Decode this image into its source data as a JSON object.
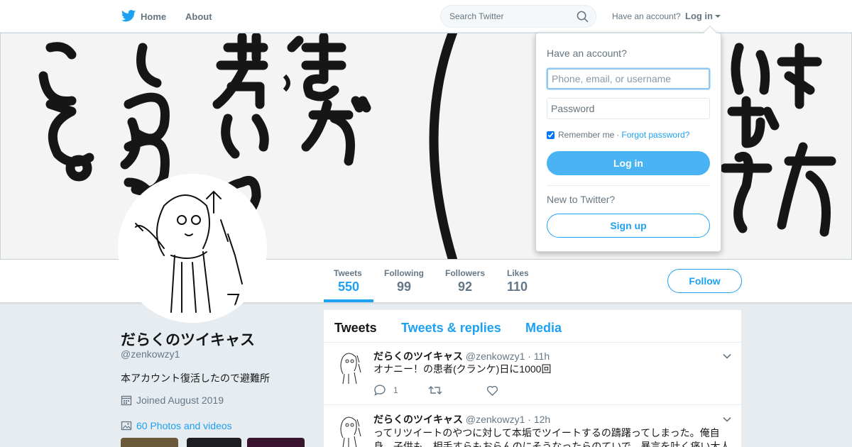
{
  "nav": {
    "home_label": "Home",
    "about_label": "About",
    "search_placeholder": "Search Twitter",
    "have_account": "Have an account?",
    "login_label": "Log in"
  },
  "profile": {
    "name": "だらくのツイキャス",
    "handle": "@zenkowzy1",
    "bio": "本アカウント復活したので避難所",
    "joined": "Joined August 2019",
    "photos_link": "60 Photos and videos",
    "follow_label": "Follow"
  },
  "stats": [
    {
      "label": "Tweets",
      "value": "550"
    },
    {
      "label": "Following",
      "value": "99"
    },
    {
      "label": "Followers",
      "value": "92"
    },
    {
      "label": "Likes",
      "value": "110"
    }
  ],
  "timeline": {
    "tabs": [
      "Tweets",
      "Tweets & replies",
      "Media"
    ],
    "tweets": [
      {
        "name": "だらくのツイキャス",
        "handle": "@zenkowzy1",
        "time": "11h",
        "text": "オナニー！の患者(クランケ)日に1000回",
        "replies": "1"
      },
      {
        "name": "だらくのツイキャス",
        "handle": "@zenkowzy1",
        "time": "12h",
        "text": "ってリツイートのやつに対して本垢でツイートするの躊躇ってしまった。俺自",
        "text2": "身、子供も、相手すらもおらんのにそうなったらのていで、暴言を吐く痛い大人"
      }
    ]
  },
  "login_dropdown": {
    "title": "Have an account?",
    "username_placeholder": "Phone, email, or username",
    "password_placeholder": "Password",
    "remember_label": "Remember me",
    "separator": "·",
    "forgot_label": "Forgot password?",
    "login_button": "Log in",
    "new_to_twitter": "New to Twitter?",
    "signup_button": "Sign up"
  },
  "colors": {
    "accent": "#1da1f2",
    "login_button": "#4ab3f4",
    "background": "#e6ecf0"
  }
}
